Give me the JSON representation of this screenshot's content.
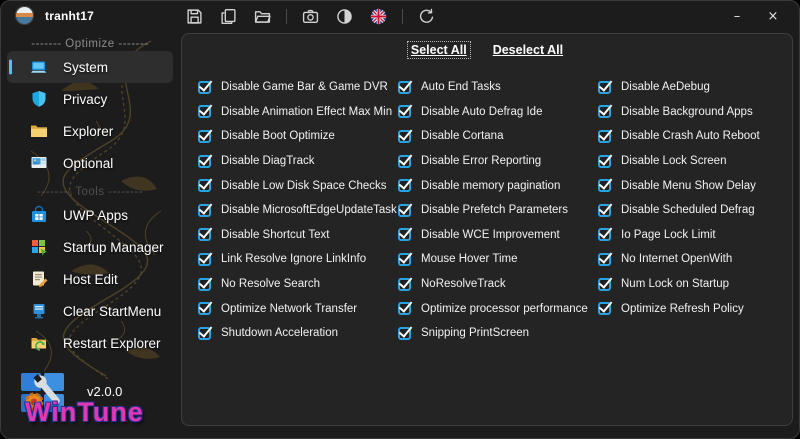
{
  "window": {
    "user": {
      "name": "tranht17"
    },
    "controls": {
      "minimize": "–",
      "close": "×"
    }
  },
  "toolbar": {
    "items": [
      {
        "type": "icon",
        "name": "save-icon"
      },
      {
        "type": "icon",
        "name": "copy-icon"
      },
      {
        "type": "icon",
        "name": "open-folder-icon"
      },
      {
        "type": "separator"
      },
      {
        "type": "icon",
        "name": "screenshot-icon"
      },
      {
        "type": "icon",
        "name": "theme-icon"
      },
      {
        "type": "icon",
        "name": "language-flag-icon"
      },
      {
        "type": "separator"
      },
      {
        "type": "icon",
        "name": "refresh-icon"
      }
    ]
  },
  "sidebar": {
    "groups": [
      {
        "separator": "------- Optimize -------",
        "faint": false,
        "items": [
          {
            "label": "System",
            "icon": "system-icon",
            "selected": true
          },
          {
            "label": "Privacy",
            "icon": "privacy-icon",
            "selected": false
          },
          {
            "label": "Explorer",
            "icon": "explorer-icon",
            "selected": false
          },
          {
            "label": "Optional",
            "icon": "optional-icon",
            "selected": false
          }
        ]
      },
      {
        "separator": "-------- Tools --------",
        "faint": true,
        "items": [
          {
            "label": "UWP Apps",
            "icon": "uwp-apps-icon",
            "selected": false
          },
          {
            "label": "Startup Manager",
            "icon": "startup-manager-icon",
            "selected": false
          },
          {
            "label": "Host Edit",
            "icon": "host-edit-icon",
            "selected": false
          },
          {
            "label": "Clear StartMenu",
            "icon": "clear-startmenu-icon",
            "selected": false
          },
          {
            "label": "Restart Explorer",
            "icon": "restart-explorer-icon",
            "selected": false
          }
        ]
      }
    ],
    "footer": {
      "version": "v2.0.0",
      "brand": "WinTune"
    }
  },
  "main": {
    "actions": {
      "select_all": "Select All",
      "deselect_all": "Deselect All"
    },
    "columns": [
      {
        "items": [
          {
            "label": "Disable Game Bar & Game DVR",
            "checked": true
          },
          {
            "label": "Disable Animation Effect Max Min",
            "checked": true
          },
          {
            "label": "Disable Boot Optimize",
            "checked": true
          },
          {
            "label": "Disable DiagTrack",
            "checked": true
          },
          {
            "label": "Disable Low Disk Space Checks",
            "checked": true
          },
          {
            "label": "Disable MicrosoftEdgeUpdateTask",
            "checked": true
          },
          {
            "label": "Disable Shortcut Text",
            "checked": true
          },
          {
            "label": "Link Resolve Ignore LinkInfo",
            "checked": true
          },
          {
            "label": "No Resolve Search",
            "checked": true
          },
          {
            "label": "Optimize Network Transfer",
            "checked": true
          },
          {
            "label": "Shutdown Acceleration",
            "checked": true
          }
        ]
      },
      {
        "items": [
          {
            "label": "Auto End Tasks",
            "checked": true
          },
          {
            "label": "Disable Auto Defrag Ide",
            "checked": true
          },
          {
            "label": "Disable Cortana",
            "checked": true
          },
          {
            "label": "Disable Error Reporting",
            "checked": true
          },
          {
            "label": "Disable memory pagination",
            "checked": true
          },
          {
            "label": "Disable Prefetch Parameters",
            "checked": true
          },
          {
            "label": "Disable WCE Improvement",
            "checked": true
          },
          {
            "label": "Mouse Hover Time",
            "checked": true
          },
          {
            "label": "NoResolveTrack",
            "checked": true
          },
          {
            "label": "Optimize processor performance",
            "checked": true
          },
          {
            "label": "Snipping PrintScreen",
            "checked": true
          }
        ]
      },
      {
        "items": [
          {
            "label": "Disable AeDebug",
            "checked": true
          },
          {
            "label": "Disable Background Apps",
            "checked": true
          },
          {
            "label": "Disable Crash Auto Reboot",
            "checked": true
          },
          {
            "label": "Disable Lock Screen",
            "checked": true
          },
          {
            "label": "Disable Menu Show Delay",
            "checked": true
          },
          {
            "label": "Disable Scheduled Defrag",
            "checked": true
          },
          {
            "label": "Io Page Lock Limit",
            "checked": true
          },
          {
            "label": "No Internet OpenWith",
            "checked": true
          },
          {
            "label": "Num Lock on Startup",
            "checked": true
          },
          {
            "label": "Optimize Refresh Policy",
            "checked": true
          }
        ]
      }
    ]
  },
  "colors": {
    "accent_checkbox": "#2aa3e2",
    "selected_indicator": "#4cc2ff",
    "brand_pink": "#e238b4",
    "panel_bg": "#242424",
    "window_bg": "#1c1c1c"
  }
}
